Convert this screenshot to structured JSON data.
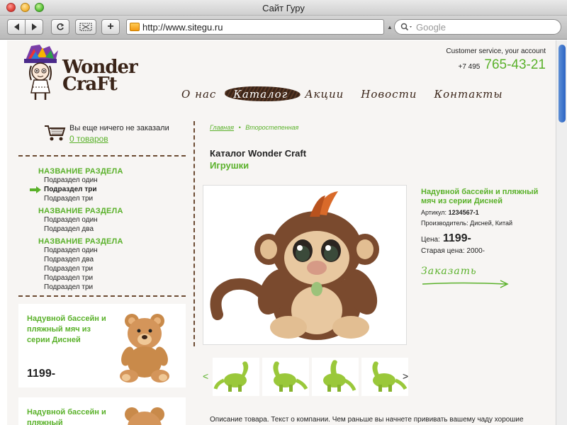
{
  "window": {
    "title": "Сайт Гуру"
  },
  "browser": {
    "url": "http://www.sitegu.ru",
    "search_placeholder": "Google"
  },
  "header": {
    "logo_text_line1": "Wonder",
    "logo_text_line2": "CraFt",
    "customer_service_label": "Customer service, your account",
    "phone_code": "+7 495",
    "phone_number": "765-43-21"
  },
  "nav": {
    "items": [
      {
        "label": "О нас",
        "active": false
      },
      {
        "label": "Каталог",
        "active": true
      },
      {
        "label": "Акции",
        "active": false
      },
      {
        "label": "Новости",
        "active": false
      },
      {
        "label": "Контакты",
        "active": false
      }
    ]
  },
  "cart": {
    "status": "Вы еще ничего не заказали",
    "count_link": "0 товаров"
  },
  "sidebar": {
    "sections": [
      {
        "title": "НАЗВАНИЕ РАЗДЕЛА",
        "items": [
          "Подраздел один",
          "Подраздел три",
          "Подраздел три"
        ],
        "current_index": 1
      },
      {
        "title": "НАЗВАНИЕ РАЗДЕЛА",
        "items": [
          "Подраздел один",
          "Подраздел два"
        ]
      },
      {
        "title": "НАЗВАНИЕ РАЗДЕЛА",
        "items": [
          "Подраздел один",
          "Подраздел два",
          "Подраздел три",
          "Подраздел три",
          "Подраздел три"
        ]
      }
    ]
  },
  "promos": [
    {
      "title": "Надувной бассейн и пляжный мяч из серии Дисней",
      "price": "1199-"
    },
    {
      "title": "Надувной бассейн и пляжный"
    }
  ],
  "breadcrumb": {
    "home": "Главная",
    "separator": "•",
    "current": "Второстепенная"
  },
  "main": {
    "title": "Каталог Wonder Craft",
    "subtitle": "Игрушки"
  },
  "product": {
    "name": "Надувной бассейн и пляжный мяч из серии Дисней",
    "article_label": "Артикул:",
    "article_value": "1234567-1",
    "manufacturer_label": "Производитель:",
    "manufacturer_value": "Дисней, Китай",
    "price_label": "Цена:",
    "price_value": "1199-",
    "old_price": "Старая цена: 2000-",
    "order_label": "Заказать",
    "thumb_prev": "<",
    "thumb_next": ">",
    "description": "Описание товара. Текст о компании. Чем раньше вы начнете прививать вашему чаду хорошие"
  },
  "colors": {
    "accent": "#5ab12a",
    "brown": "#3a2418"
  }
}
